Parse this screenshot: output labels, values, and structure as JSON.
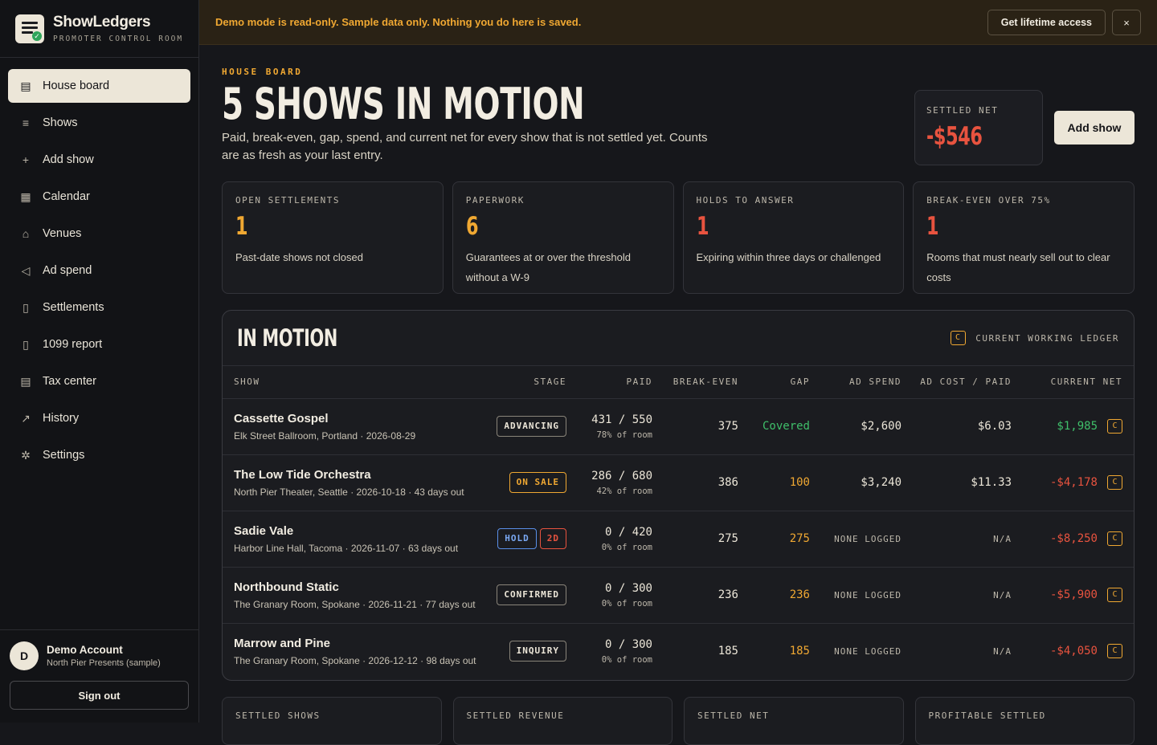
{
  "brand": {
    "name": "ShowLedgers",
    "subtitle": "PROMOTER CONTROL ROOM"
  },
  "nav": [
    {
      "label": "House board",
      "icon": "board-icon",
      "active": true
    },
    {
      "label": "Shows",
      "icon": "list-icon"
    },
    {
      "label": "Add show",
      "icon": "plus-icon"
    },
    {
      "label": "Calendar",
      "icon": "calendar-icon"
    },
    {
      "label": "Venues",
      "icon": "venue-icon"
    },
    {
      "label": "Ad spend",
      "icon": "megaphone-icon"
    },
    {
      "label": "Settlements",
      "icon": "receipt-icon"
    },
    {
      "label": "1099 report",
      "icon": "document-icon"
    },
    {
      "label": "Tax center",
      "icon": "ledger-icon"
    },
    {
      "label": "History",
      "icon": "chart-icon"
    },
    {
      "label": "Settings",
      "icon": "gear-icon"
    }
  ],
  "account": {
    "initial": "D",
    "name": "Demo Account",
    "org": "North Pier Presents (sample)",
    "signout": "Sign out"
  },
  "banner": {
    "text": "Demo mode is read-only. Sample data only. Nothing you do here is saved.",
    "cta": "Get lifetime access",
    "close": "×"
  },
  "header": {
    "eyebrow": "HOUSE BOARD",
    "title": "5 SHOWS IN MOTION",
    "description": "Paid, break-even, gap, spend, and current net for every show that is not settled yet. Counts are as fresh as your last entry.",
    "settled_label": "SETTLED NET",
    "settled_value": "-$546",
    "add_show": "Add show"
  },
  "stats": [
    {
      "label": "OPEN SETTLEMENTS",
      "value": "1",
      "desc": "Past-date shows not closed",
      "color": "#f0a832"
    },
    {
      "label": "PAPERWORK",
      "value": "6",
      "desc": "Guarantees at or over the threshold without a W-9",
      "color": "#f0a832"
    },
    {
      "label": "HOLDS TO ANSWER",
      "value": "1",
      "desc": "Expiring within three days or challenged",
      "color": "#e8533f"
    },
    {
      "label": "BREAK-EVEN OVER 75%",
      "value": "1",
      "desc": "Rooms that must nearly sell out to clear costs",
      "color": "#e8533f"
    }
  ],
  "in_motion": {
    "title": "IN MOTION",
    "ledger_badge": "C",
    "ledger_note": "CURRENT WORKING LEDGER",
    "columns": [
      "SHOW",
      "STAGE",
      "PAID",
      "BREAK-EVEN",
      "GAP",
      "AD SPEND",
      "AD COST / PAID",
      "CURRENT NET"
    ],
    "rows": [
      {
        "name": "Cassette Gospel",
        "meta": "Elk Street Ballroom, Portland · 2026-08-29",
        "stage": "ADVANCING",
        "stage_style": "plain",
        "paid": "431 / 550",
        "room": "78% of room",
        "break_even": "375",
        "gap": "Covered",
        "gap_color": "#3fbf6a",
        "ad_spend": "$2,600",
        "ad_cost": "$6.03",
        "net": "$1,985",
        "net_color": "#3fbf6a",
        "badge": "C"
      },
      {
        "name": "The Low Tide Orchestra",
        "meta": "North Pier Theater, Seattle · 2026-10-18 · 43 days out",
        "stage": "ON SALE",
        "stage_style": "onsale",
        "paid": "286 / 680",
        "room": "42% of room",
        "break_even": "386",
        "gap": "100",
        "gap_color": "#f0a832",
        "ad_spend": "$3,240",
        "ad_cost": "$11.33",
        "net": "-$4,178",
        "net_color": "#e8533f",
        "badge": "C"
      },
      {
        "name": "Sadie Vale",
        "meta": "Harbor Line Hall, Tacoma · 2026-11-07 · 63 days out",
        "stage": "HOLD",
        "stage_style": "hold",
        "stage_extra": "2D",
        "paid": "0 / 420",
        "room": "0% of room",
        "break_even": "275",
        "gap": "275",
        "gap_color": "#f0a832",
        "ad_spend": "NONE LOGGED",
        "ad_cost": "N/A",
        "net": "-$8,250",
        "net_color": "#e8533f",
        "badge": "C"
      },
      {
        "name": "Northbound Static",
        "meta": "The Granary Room, Spokane · 2026-11-21 · 77 days out",
        "stage": "CONFIRMED",
        "stage_style": "plain",
        "paid": "0 / 300",
        "room": "0% of room",
        "break_even": "236",
        "gap": "236",
        "gap_color": "#f0a832",
        "ad_spend": "NONE LOGGED",
        "ad_cost": "N/A",
        "net": "-$5,900",
        "net_color": "#e8533f",
        "badge": "C"
      },
      {
        "name": "Marrow and Pine",
        "meta": "The Granary Room, Spokane · 2026-12-12 · 98 days out",
        "stage": "INQUIRY",
        "stage_style": "plain",
        "paid": "0 / 300",
        "room": "0% of room",
        "break_even": "185",
        "gap": "185",
        "gap_color": "#f0a832",
        "ad_spend": "NONE LOGGED",
        "ad_cost": "N/A",
        "net": "-$4,050",
        "net_color": "#e8533f",
        "badge": "C"
      }
    ]
  },
  "bottom_cards": [
    "SETTLED SHOWS",
    "SETTLED REVENUE",
    "SETTLED NET",
    "PROFITABLE SETTLED"
  ]
}
